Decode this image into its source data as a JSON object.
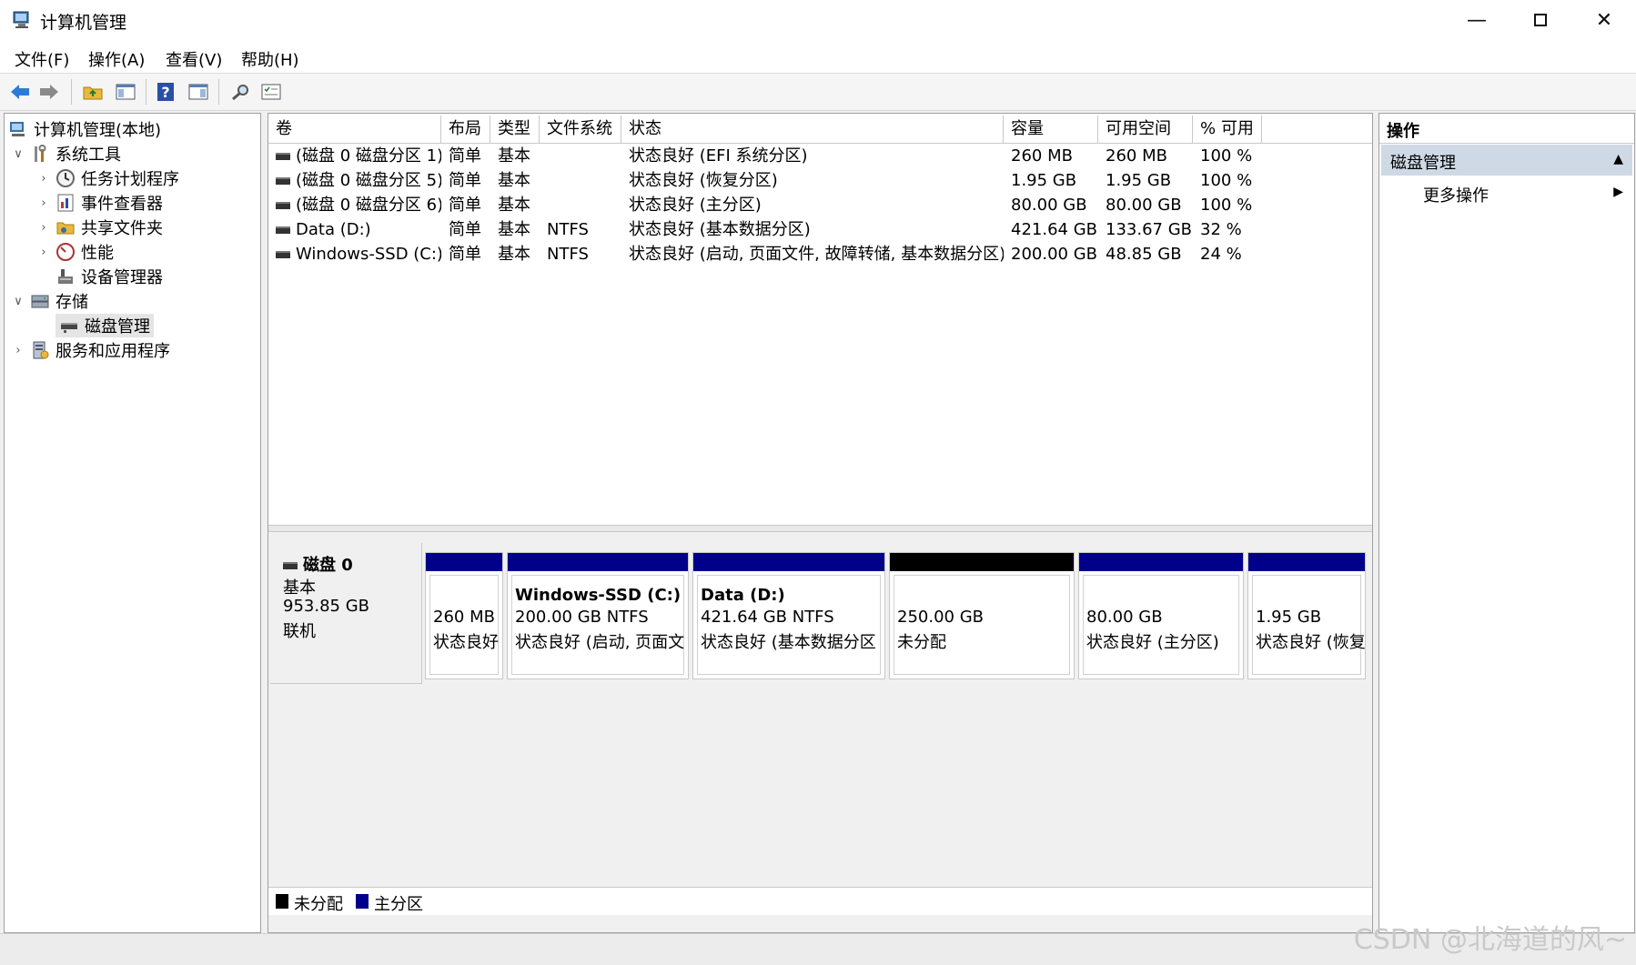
{
  "window": {
    "title": "计算机管理"
  },
  "menu": [
    "文件(F)",
    "操作(A)",
    "查看(V)",
    "帮助(H)"
  ],
  "tree": {
    "root": "计算机管理(本地)",
    "system_tools": "系统工具",
    "task_scheduler": "任务计划程序",
    "event_viewer": "事件查看器",
    "shared_folders": "共享文件夹",
    "performance": "性能",
    "device_manager": "设备管理器",
    "storage": "存储",
    "disk_management": "磁盘管理",
    "services_apps": "服务和应用程序"
  },
  "volumes": {
    "columns": [
      "卷",
      "布局",
      "类型",
      "文件系统",
      "状态",
      "容量",
      "可用空间",
      "% 可用"
    ],
    "rows": [
      [
        "(磁盘 0 磁盘分区 1)",
        "简单",
        "基本",
        "",
        "状态良好 (EFI 系统分区)",
        "260 MB",
        "260 MB",
        "100 %"
      ],
      [
        "(磁盘 0 磁盘分区 5)",
        "简单",
        "基本",
        "",
        "状态良好 (恢复分区)",
        "1.95 GB",
        "1.95 GB",
        "100 %"
      ],
      [
        "(磁盘 0 磁盘分区 6)",
        "简单",
        "基本",
        "",
        "状态良好 (主分区)",
        "80.00 GB",
        "80.00 GB",
        "100 %"
      ],
      [
        "Data (D:)",
        "简单",
        "基本",
        "NTFS",
        "状态良好 (基本数据分区)",
        "421.64 GB",
        "133.67 GB",
        "32 %"
      ],
      [
        "Windows-SSD (C:)",
        "简单",
        "基本",
        "NTFS",
        "状态良好 (启动, 页面文件, 故障转储, 基本数据分区)",
        "200.00 GB",
        "48.85 GB",
        "24 %"
      ]
    ]
  },
  "disk": {
    "name": "磁盘 0",
    "type": "基本",
    "size": "953.85 GB",
    "status": "联机",
    "partitions": [
      {
        "title": "",
        "line1": "260 MB",
        "line2": "状态良好",
        "kind": "primary"
      },
      {
        "title": "Windows-SSD  (C:)",
        "line1": "200.00 GB NTFS",
        "line2": "状态良好 (启动, 页面文",
        "kind": "primary"
      },
      {
        "title": "Data  (D:)",
        "line1": "421.64 GB NTFS",
        "line2": "状态良好 (基本数据分区",
        "kind": "primary"
      },
      {
        "title": "",
        "line1": "250.00 GB",
        "line2": "未分配",
        "kind": "unallocated"
      },
      {
        "title": "",
        "line1": "80.00 GB",
        "line2": "状态良好 (主分区)",
        "kind": "primary"
      },
      {
        "title": "",
        "line1": "1.95 GB",
        "line2": "状态良好 (恢复",
        "kind": "primary"
      }
    ]
  },
  "legend": {
    "unallocated": "未分配",
    "primary": "主分区"
  },
  "colors": {
    "primary": "#00008b",
    "unallocated": "#000000",
    "section": "#cfd9e6"
  },
  "actions": {
    "header": "操作",
    "section": "磁盘管理",
    "more": "更多操作"
  },
  "watermark": "CSDN @北海道的风~"
}
